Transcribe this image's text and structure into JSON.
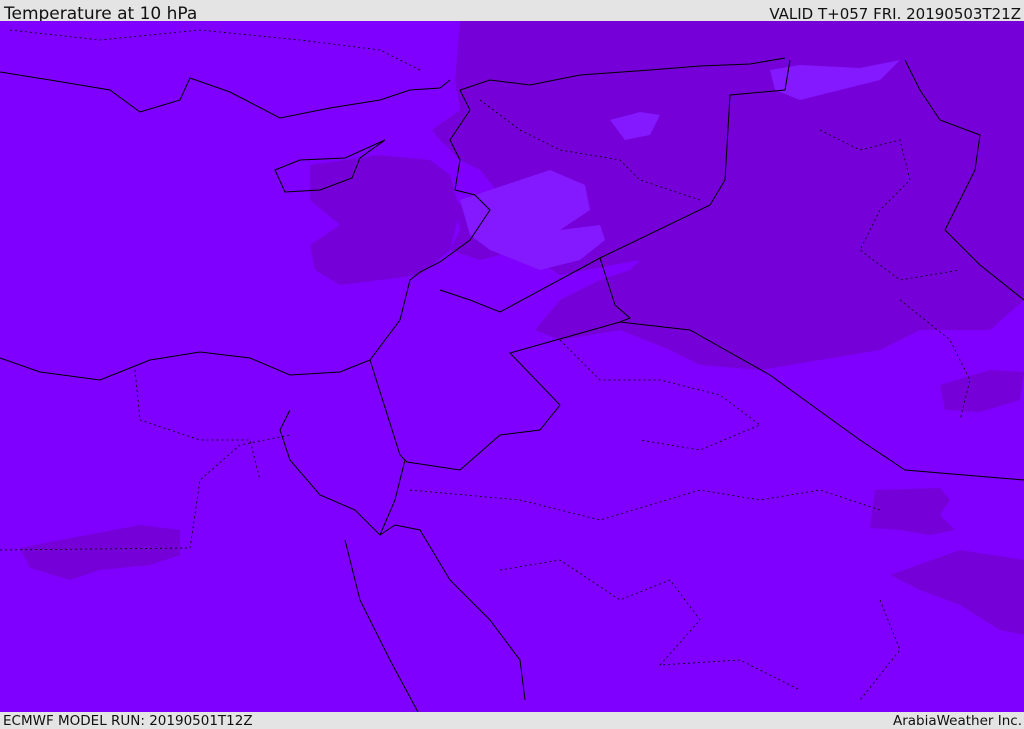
{
  "header": {
    "title": "Temperature at 10 hPa",
    "valid": "VALID T+057 FRI. 20190503T21Z"
  },
  "footer": {
    "model_run": "ECMWF MODEL RUN: 20190501T12Z",
    "brand": "ArabiaWeather Inc."
  },
  "map": {
    "fill_color": "#7f00ff",
    "warm_region_color": "#7600d8",
    "cool_region_color": "#8416ff"
  }
}
